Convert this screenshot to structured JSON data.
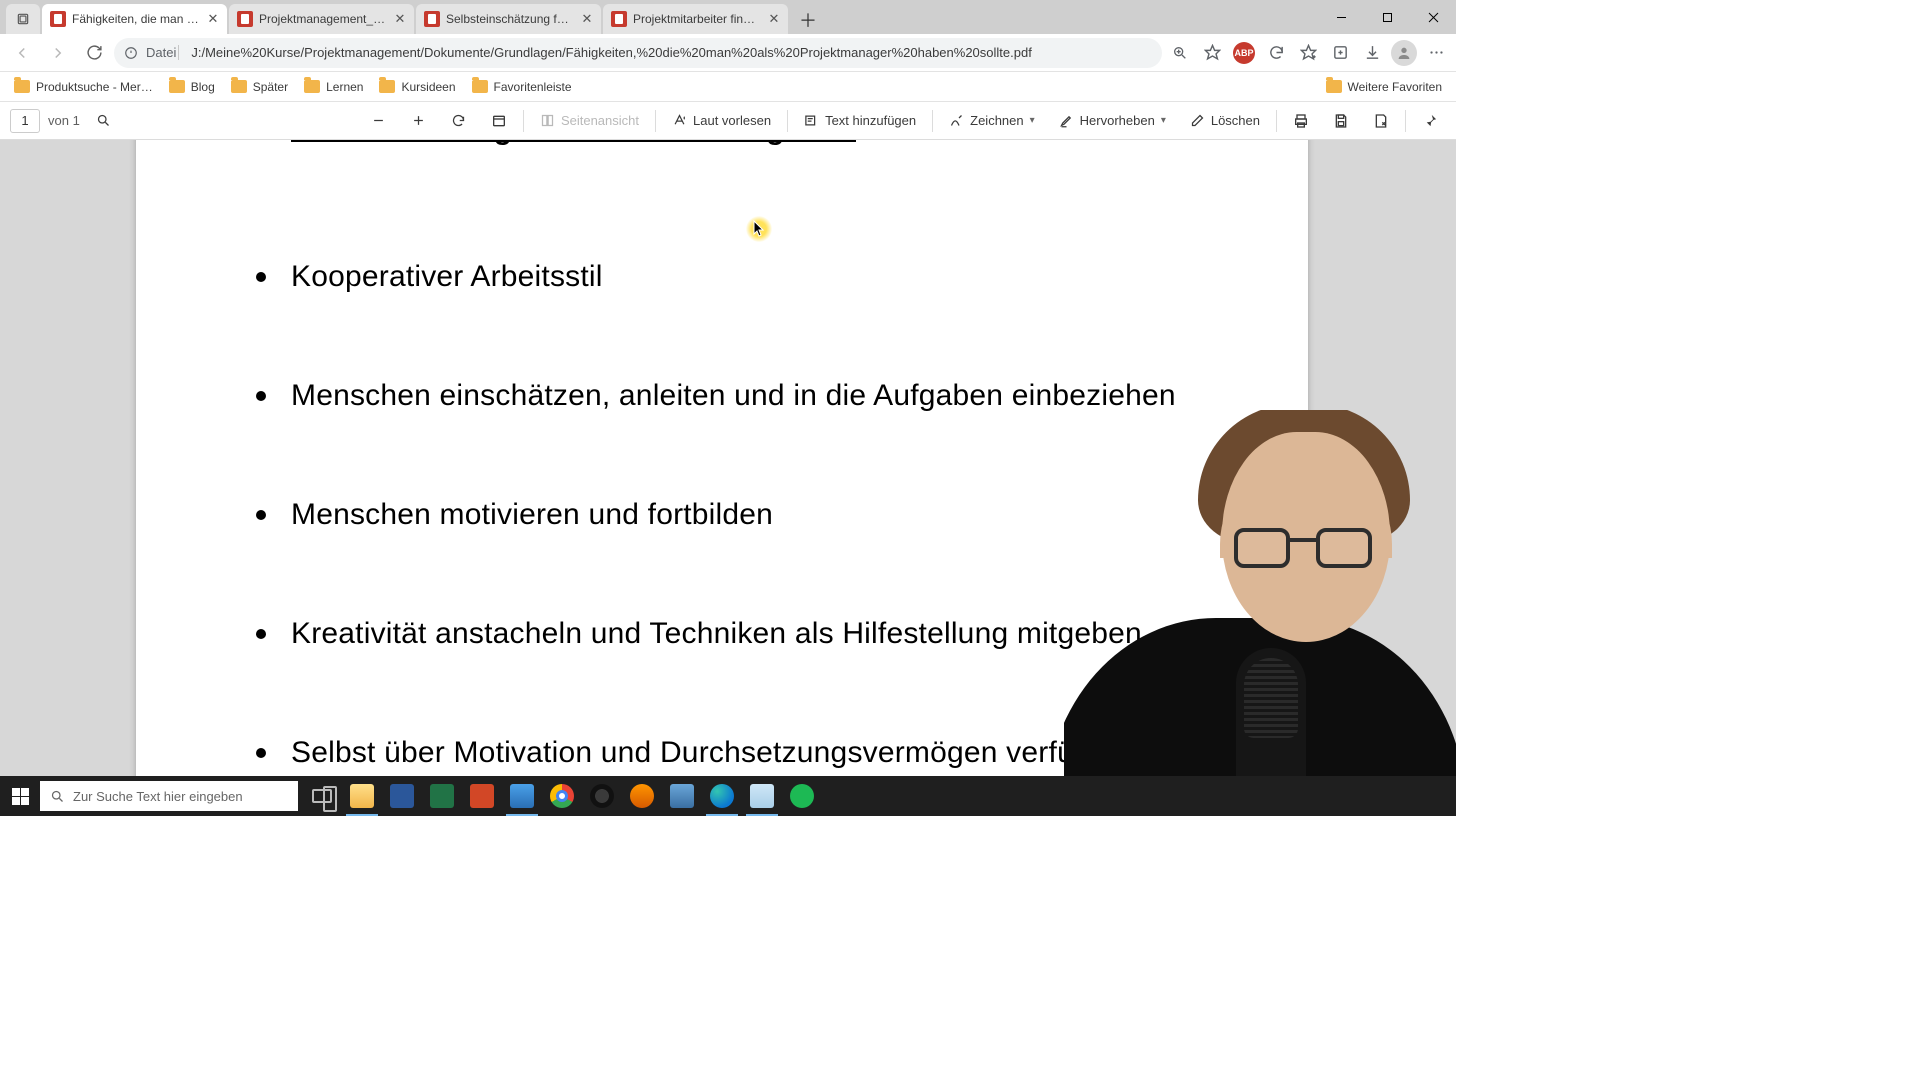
{
  "tabs": [
    {
      "title": "Fähigkeiten, die man als Projekt"
    },
    {
      "title": "Projektmanagement_Einstiegsfr"
    },
    {
      "title": "Selbsteinschätzung für Projektm"
    },
    {
      "title": "Projektmitarbeiter finden - was s"
    }
  ],
  "address": {
    "scheme": "Datei",
    "path": "J:/Meine%20Kurse/Projektmanagement/Dokumente/Grundlagen/Fähigkeiten,%20die%20man%20als%20Projektmanager%20haben%20sollte.pdf"
  },
  "bookmarks": {
    "items": [
      "Produktsuche - Mer…",
      "Blog",
      "Später",
      "Lernen",
      "Kursideen",
      "Favoritenleiste"
    ],
    "more": "Weitere Favoriten"
  },
  "pdf_toolbar": {
    "page": "1",
    "page_of": "von 1",
    "page_view": "Seitenansicht",
    "read_aloud": "Laut vorlesen",
    "add_text": "Text hinzufügen",
    "draw": "Zeichnen",
    "highlight": "Hervorheben",
    "erase": "Löschen"
  },
  "document": {
    "items": [
      "Planen und organisieren von Aufgaben",
      "Kooperativer Arbeitsstil",
      "Menschen einschätzen, anleiten und in die Aufgaben einbeziehen",
      "Menschen motivieren und fortbilden",
      "Kreativität anstacheln und Techniken als Hilfestellung mitgeben",
      "Selbst über Motivation und Durchsetzungsvermögen verfügen"
    ]
  },
  "taskbar": {
    "search_placeholder": "Zur Suche Text hier eingeben"
  }
}
